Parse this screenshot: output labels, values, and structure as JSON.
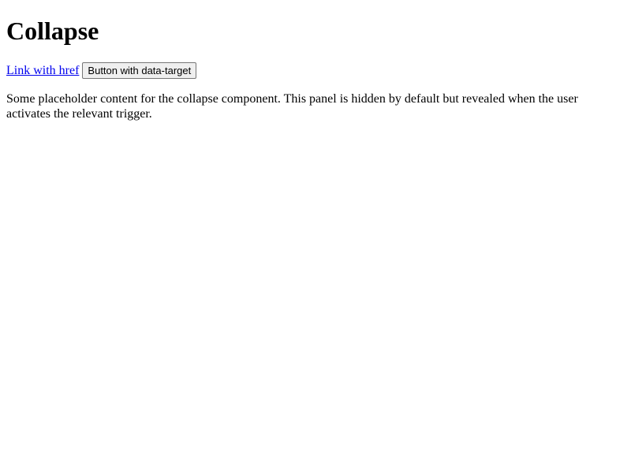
{
  "page": {
    "title": "Collapse"
  },
  "triggers": {
    "link_label": "Link with href ",
    "button_label": "Button with data-target"
  },
  "collapse": {
    "content": "Some placeholder content for the collapse component. This panel is hidden by default but revealed when the user activates the relevant trigger."
  },
  "colors": {
    "link": "#0000ee",
    "text": "#000000",
    "button_bg": "#efefef",
    "button_border": "#767676"
  }
}
